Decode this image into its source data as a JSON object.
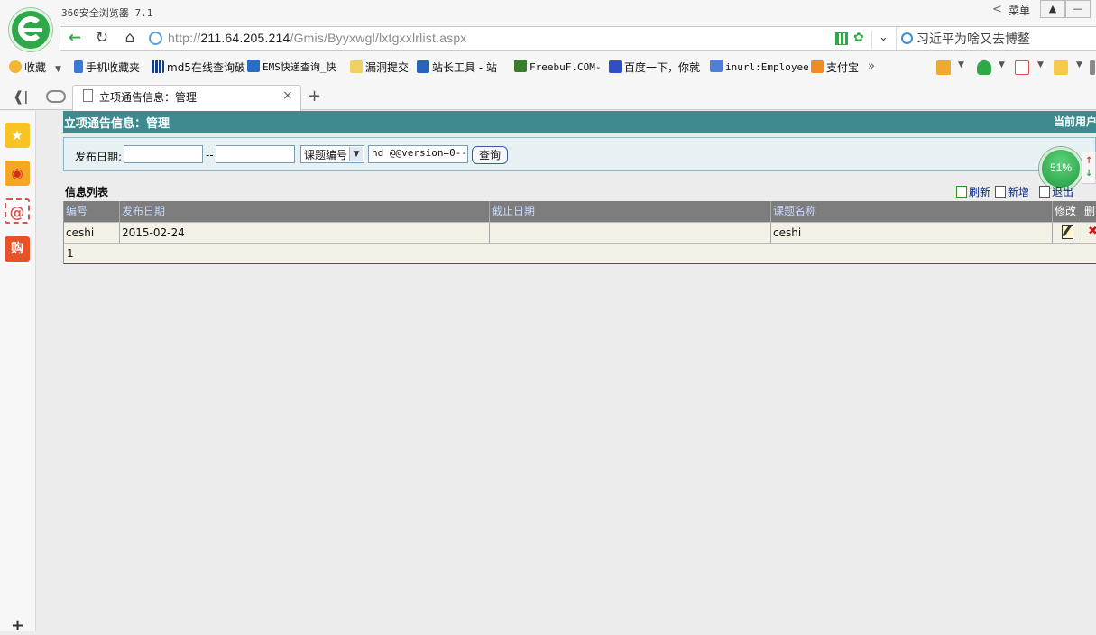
{
  "browser": {
    "title": "360安全浏览器 7.1",
    "menu_label": "菜单",
    "back_arrow": "<",
    "url_scheme": "http://",
    "url_host": "211.64.205.214",
    "url_path": "/Gmis/Byyxwgl/lxtgxxlrlist.aspx",
    "search_text": "习近平为啥又去博鳌",
    "bookmarks": {
      "favorites": "收藏",
      "mobile": "手机收藏夹",
      "md5": "md5在线查询破",
      "ems": "EMS快递查询_快",
      "vuln": "漏洞提交",
      "webmaster": "站长工具 - 站",
      "freebuf": "FreebuF.COM-",
      "baidu": "百度一下，你就",
      "inurl": "inurl:Employee",
      "alipay": "支付宝",
      "more": "»"
    },
    "tab": {
      "label": "立项通告信息：管理",
      "close": "×",
      "new": "+"
    }
  },
  "sidebar": {
    "mail_symbol": "@",
    "shop_symbol": "购",
    "add_symbol": "+"
  },
  "page": {
    "title": "立项通告信息：管理",
    "user_label": "当前用户",
    "search": {
      "date_label": "发布日期:",
      "date_from": "",
      "date_to": "",
      "date_separator": "--",
      "field_selected": "课题编号",
      "keyword": "nd @@version=0--",
      "query_button": "查询"
    },
    "progress_percent": "51%",
    "list_title": "信息列表",
    "actions": {
      "refresh": "刷新",
      "add": "新增",
      "exit": "退出"
    },
    "table": {
      "headers": [
        "编号",
        "发布日期",
        "截止日期",
        "课题名称",
        "修改",
        "删"
      ],
      "rows": [
        {
          "id": "ceshi",
          "publish_date": "2015-02-24",
          "deadline": "",
          "topic": "ceshi"
        }
      ],
      "pager": "1"
    }
  },
  "colors": {
    "header_teal": "#3e8b8f",
    "brand_green": "#2fa84a",
    "link_blue": "#0a2a88"
  }
}
